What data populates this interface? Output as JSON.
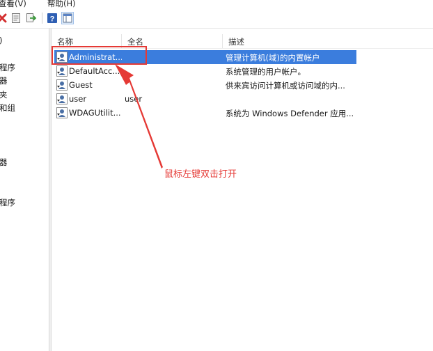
{
  "menu": {
    "view_label": "查看(V)",
    "help_label": "帮助(H)"
  },
  "toolbar": {
    "icons": [
      "delete-icon",
      "properties-icon",
      "export-list-icon",
      "help-icon",
      "show-hide-pane-icon"
    ]
  },
  "tree": {
    "items": [
      ")",
      "程序",
      "器",
      "夹",
      "和组",
      "器",
      "程序"
    ]
  },
  "columns": [
    "名称",
    "全名",
    "描述"
  ],
  "rows": [
    {
      "name": "Administrat...",
      "full": "",
      "desc": "管理计算机(域)的内置帐户",
      "selected": true
    },
    {
      "name": "DefaultAcc...",
      "full": "",
      "desc": "系统管理的用户帐户。",
      "selected": false
    },
    {
      "name": "Guest",
      "full": "",
      "desc": "供来宾访问计算机或访问域的内...",
      "selected": false
    },
    {
      "name": "user",
      "full": "user",
      "desc": "",
      "selected": false
    },
    {
      "name": "WDAGUtilit...",
      "full": "",
      "desc": "系统为 Windows Defender 应用...",
      "selected": false
    }
  ],
  "annotation": {
    "text": "鼠标左键双击打开",
    "color": "#e53935"
  },
  "colors": {
    "selection": "#3b7ddd",
    "annotation_red": "#e53935"
  }
}
